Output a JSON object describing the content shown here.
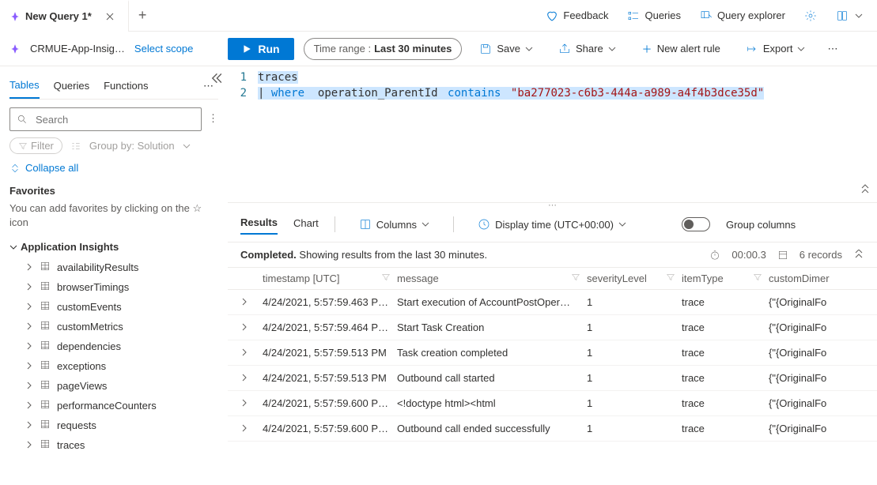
{
  "top": {
    "tab_title": "New Query 1*",
    "feedback": "Feedback",
    "queries": "Queries",
    "query_explorer": "Query explorer"
  },
  "scope": {
    "resource": "CRMUE-App-Insig…",
    "select_scope": "Select scope",
    "run": "Run",
    "time_range_label": "Time range :",
    "time_range_value": "Last 30 minutes",
    "save": "Save",
    "share": "Share",
    "new_alert": "New alert rule",
    "export": "Export"
  },
  "sidebar": {
    "tabs": {
      "tables": "Tables",
      "queries": "Queries",
      "functions": "Functions"
    },
    "search_placeholder": "Search",
    "filter": "Filter",
    "group_by": "Group by: Solution",
    "collapse_all": "Collapse all",
    "favorites_h": "Favorites",
    "favorites_txt": "You can add favorites by clicking on the ☆ icon",
    "tree_h": "Application Insights",
    "items": [
      "availabilityResults",
      "browserTimings",
      "customEvents",
      "customMetrics",
      "dependencies",
      "exceptions",
      "pageViews",
      "performanceCounters",
      "requests",
      "traces"
    ]
  },
  "code": {
    "l1": "traces",
    "pipe": "|",
    "where": "where",
    "field": "operation_ParentId",
    "contains": "contains",
    "string": "\"ba277023-c6b3-444a-a989-a4f4b3dce35d\""
  },
  "results": {
    "tabs": {
      "results": "Results",
      "chart": "Chart"
    },
    "columns": "Columns",
    "display_time": "Display time (UTC+00:00)",
    "group_cols": "Group columns",
    "completed": "Completed.",
    "completed_suffix": " Showing results from the last 30 minutes.",
    "duration": "00:00.3",
    "records": "6 records",
    "headers": {
      "timestamp": "timestamp [UTC]",
      "message": "message",
      "severity": "severityLevel",
      "itemType": "itemType",
      "custom": "customDimer"
    },
    "rows": [
      {
        "ts": "4/24/2021, 5:57:59.463 P…",
        "msg": "Start execution of AccountPostOper…",
        "sev": "1",
        "it": "trace",
        "cd": "{\"{OriginalFo"
      },
      {
        "ts": "4/24/2021, 5:57:59.464 P…",
        "msg": "Start Task Creation",
        "sev": "1",
        "it": "trace",
        "cd": "{\"{OriginalFo"
      },
      {
        "ts": "4/24/2021, 5:57:59.513 PM",
        "msg": "Task creation completed",
        "sev": "1",
        "it": "trace",
        "cd": "{\"{OriginalFo"
      },
      {
        "ts": "4/24/2021, 5:57:59.513 PM",
        "msg": "Outbound call started",
        "sev": "1",
        "it": "trace",
        "cd": "{\"{OriginalFo"
      },
      {
        "ts": "4/24/2021, 5:57:59.600 P…",
        "msg": "<!doctype html><html",
        "sev": "1",
        "it": "trace",
        "cd": "{\"{OriginalFo"
      },
      {
        "ts": "4/24/2021, 5:57:59.600 P…",
        "msg": "Outbound call ended successfully",
        "sev": "1",
        "it": "trace",
        "cd": "{\"{OriginalFo"
      }
    ]
  }
}
